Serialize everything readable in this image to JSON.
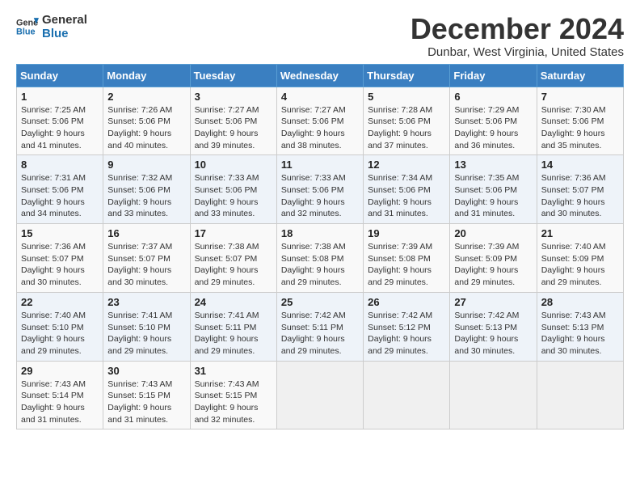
{
  "header": {
    "logo_general": "General",
    "logo_blue": "Blue",
    "month_title": "December 2024",
    "location": "Dunbar, West Virginia, United States"
  },
  "weekdays": [
    "Sunday",
    "Monday",
    "Tuesday",
    "Wednesday",
    "Thursday",
    "Friday",
    "Saturday"
  ],
  "weeks": [
    [
      {
        "day": "1",
        "sunrise": "7:25 AM",
        "sunset": "5:06 PM",
        "daylight": "9 hours and 41 minutes."
      },
      {
        "day": "2",
        "sunrise": "7:26 AM",
        "sunset": "5:06 PM",
        "daylight": "9 hours and 40 minutes."
      },
      {
        "day": "3",
        "sunrise": "7:27 AM",
        "sunset": "5:06 PM",
        "daylight": "9 hours and 39 minutes."
      },
      {
        "day": "4",
        "sunrise": "7:27 AM",
        "sunset": "5:06 PM",
        "daylight": "9 hours and 38 minutes."
      },
      {
        "day": "5",
        "sunrise": "7:28 AM",
        "sunset": "5:06 PM",
        "daylight": "9 hours and 37 minutes."
      },
      {
        "day": "6",
        "sunrise": "7:29 AM",
        "sunset": "5:06 PM",
        "daylight": "9 hours and 36 minutes."
      },
      {
        "day": "7",
        "sunrise": "7:30 AM",
        "sunset": "5:06 PM",
        "daylight": "9 hours and 35 minutes."
      }
    ],
    [
      {
        "day": "8",
        "sunrise": "7:31 AM",
        "sunset": "5:06 PM",
        "daylight": "9 hours and 34 minutes."
      },
      {
        "day": "9",
        "sunrise": "7:32 AM",
        "sunset": "5:06 PM",
        "daylight": "9 hours and 33 minutes."
      },
      {
        "day": "10",
        "sunrise": "7:33 AM",
        "sunset": "5:06 PM",
        "daylight": "9 hours and 33 minutes."
      },
      {
        "day": "11",
        "sunrise": "7:33 AM",
        "sunset": "5:06 PM",
        "daylight": "9 hours and 32 minutes."
      },
      {
        "day": "12",
        "sunrise": "7:34 AM",
        "sunset": "5:06 PM",
        "daylight": "9 hours and 31 minutes."
      },
      {
        "day": "13",
        "sunrise": "7:35 AM",
        "sunset": "5:06 PM",
        "daylight": "9 hours and 31 minutes."
      },
      {
        "day": "14",
        "sunrise": "7:36 AM",
        "sunset": "5:07 PM",
        "daylight": "9 hours and 30 minutes."
      }
    ],
    [
      {
        "day": "15",
        "sunrise": "7:36 AM",
        "sunset": "5:07 PM",
        "daylight": "9 hours and 30 minutes."
      },
      {
        "day": "16",
        "sunrise": "7:37 AM",
        "sunset": "5:07 PM",
        "daylight": "9 hours and 30 minutes."
      },
      {
        "day": "17",
        "sunrise": "7:38 AM",
        "sunset": "5:07 PM",
        "daylight": "9 hours and 29 minutes."
      },
      {
        "day": "18",
        "sunrise": "7:38 AM",
        "sunset": "5:08 PM",
        "daylight": "9 hours and 29 minutes."
      },
      {
        "day": "19",
        "sunrise": "7:39 AM",
        "sunset": "5:08 PM",
        "daylight": "9 hours and 29 minutes."
      },
      {
        "day": "20",
        "sunrise": "7:39 AM",
        "sunset": "5:09 PM",
        "daylight": "9 hours and 29 minutes."
      },
      {
        "day": "21",
        "sunrise": "7:40 AM",
        "sunset": "5:09 PM",
        "daylight": "9 hours and 29 minutes."
      }
    ],
    [
      {
        "day": "22",
        "sunrise": "7:40 AM",
        "sunset": "5:10 PM",
        "daylight": "9 hours and 29 minutes."
      },
      {
        "day": "23",
        "sunrise": "7:41 AM",
        "sunset": "5:10 PM",
        "daylight": "9 hours and 29 minutes."
      },
      {
        "day": "24",
        "sunrise": "7:41 AM",
        "sunset": "5:11 PM",
        "daylight": "9 hours and 29 minutes."
      },
      {
        "day": "25",
        "sunrise": "7:42 AM",
        "sunset": "5:11 PM",
        "daylight": "9 hours and 29 minutes."
      },
      {
        "day": "26",
        "sunrise": "7:42 AM",
        "sunset": "5:12 PM",
        "daylight": "9 hours and 29 minutes."
      },
      {
        "day": "27",
        "sunrise": "7:42 AM",
        "sunset": "5:13 PM",
        "daylight": "9 hours and 30 minutes."
      },
      {
        "day": "28",
        "sunrise": "7:43 AM",
        "sunset": "5:13 PM",
        "daylight": "9 hours and 30 minutes."
      }
    ],
    [
      {
        "day": "29",
        "sunrise": "7:43 AM",
        "sunset": "5:14 PM",
        "daylight": "9 hours and 31 minutes."
      },
      {
        "day": "30",
        "sunrise": "7:43 AM",
        "sunset": "5:15 PM",
        "daylight": "9 hours and 31 minutes."
      },
      {
        "day": "31",
        "sunrise": "7:43 AM",
        "sunset": "5:15 PM",
        "daylight": "9 hours and 32 minutes."
      },
      null,
      null,
      null,
      null
    ]
  ]
}
